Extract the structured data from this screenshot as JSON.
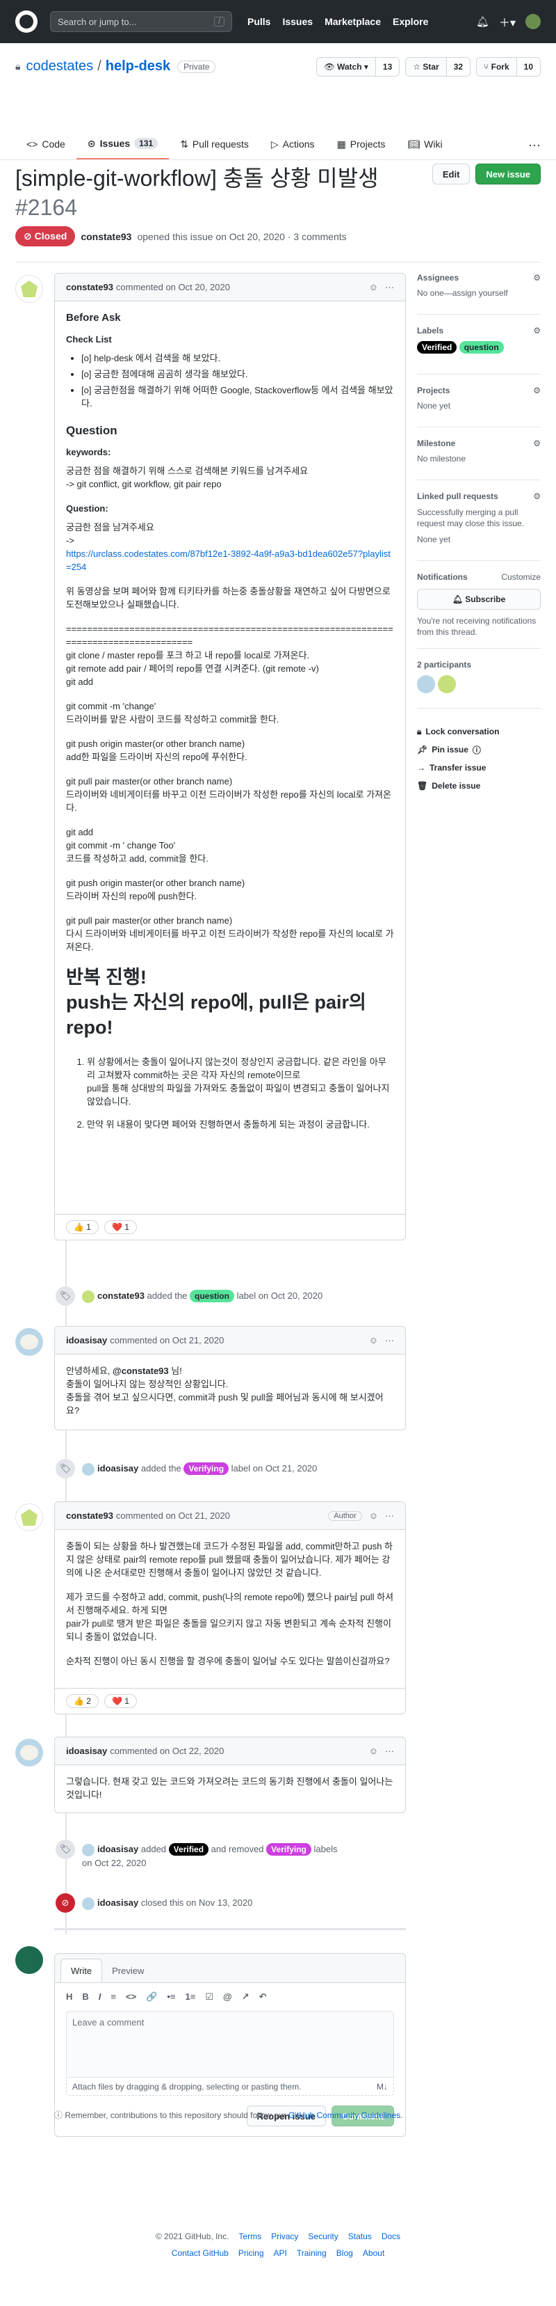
{
  "header": {
    "search_placeholder": "Search or jump to...",
    "slash": "/",
    "nav": [
      "Pulls",
      "Issues",
      "Marketplace",
      "Explore"
    ]
  },
  "repo": {
    "owner": "codestates",
    "name": "help-desk",
    "visibility": "Private",
    "watch": "Watch",
    "watch_count": "13",
    "star": "Star",
    "star_count": "32",
    "fork": "Fork",
    "fork_count": "10"
  },
  "tabs": [
    {
      "label": "Code"
    },
    {
      "label": "Issues",
      "count": "131"
    },
    {
      "label": "Pull requests"
    },
    {
      "label": "Actions"
    },
    {
      "label": "Projects"
    },
    {
      "label": "Wiki"
    }
  ],
  "issue": {
    "title": "[simple-git-workflow] 충돌 상황 미발생",
    "number": "#2164",
    "edit": "Edit",
    "new_issue": "New issue",
    "state": "Closed",
    "author": "constate93",
    "opened_text": "opened this issue on Oct 20, 2020 · 3 comments"
  },
  "c1": {
    "author": "constate93",
    "meta": "commented on Oct 20, 2020",
    "h_before": "Before Ask",
    "h_check": "Check List",
    "checks": [
      "[o] help-desk 에서 검색을 해 보았다.",
      "[o] 궁금한 점에대해 곰곰히 생각을 해보았다.",
      "[o] 궁금한점을 해결하기 위해 어떠한 Google, Stackoverflow등 에서 검색을 해보았다."
    ],
    "h_question": "Question",
    "kw_label": "keywords:",
    "kw1": "궁금한 점을 해결하기 위해 스스로 검색해본 키워드를 남겨주세요",
    "kw2": "-> git conflict, git workflow, git pair repo",
    "q_label": "Question:",
    "q1": "궁금한 점을 남겨주세요",
    "q2": "->",
    "link": "https://urclass.codestates.com/87bf12e1-3892-4a9f-a9a3-bd1dea602e57?playlist=254",
    "p1": "위 동영상을 보며 페어와 함께 티키타카를 하는중 충돌상황을 재연하고 싶어 다방면으로 도전해보았으나 실패했습니다.",
    "eq": "======================================================================================",
    "p2": "git clone / master repo를 포크 하고 내 repo를 local로 가져온다.\ngit remote add pair / 페어의 repo를 연결 시켜준다. (git remote -v)\ngit add",
    "p3": "git commit -m 'change'\n드라이버를 맡은 사람이 코드를 작성하고 commit을 한다.",
    "p4": "git push origin master(or other branch name)\nadd한 파일을 드라이버 자신의 repo에 푸쉬한다.",
    "p5": "git pull pair master(or other branch name)\n드라이버와 네비게이터를 바꾸고 이전 드라이버가 작성한 repo를 자신의 local로 가져온다.",
    "p6": "git add\ngit commit -m ' change Too'\n코드를 작성하고 add, commit을 한다.",
    "p7": "git push origin master(or other branch name)\n드라이버 자신의 repo에 push한다.",
    "p8": "git pull pair master(or other branch name)\n다시 드라이버와 네비게이터를 바꾸고 이전 드라이버가 작성한 repo를 자신의 local로 가져온다.",
    "big": "반복 진행!\npush는 자신의 repo에, pull은 pair의 repo!",
    "ol": [
      "위 상황에서는 충돌이 일어나지 않는것이 정상인지 궁금합니다. 같은 라인을 아무리 고쳐봤자 commit하는 곳은 각자 자신의 remote이므로\npull을 통해 상대방의 파일을 가져와도 충돌없이 파일이 변경되고 충돌이 일어나지 않았습니다.",
      "만약 위 내용이 맞다면 페어와 진행하면서 충돌하게 되는 과정이 궁금합니다."
    ],
    "r_thumb": "👍 1",
    "r_heart": "❤️ 1"
  },
  "e1": {
    "actor": "constate93",
    "pre": "added the",
    "label": "question",
    "post": "label on Oct 20, 2020"
  },
  "c2": {
    "author": "idoasisay",
    "meta": "commented on Oct 21, 2020",
    "l1a": "안녕하세요, ",
    "mention": "@constate93",
    "l1b": " 님!",
    "l2": "충돌이 일어나지 않는 정상적인 상황입니다.",
    "l3": "충돌을 겪어 보고 싶으시다면, commit과 push 및 pull을 페어님과 동시에 해 보시겠어요?"
  },
  "e2": {
    "actor": "idoasisay",
    "pre": "added the",
    "label": "Verifying",
    "post": "label on Oct 21, 2020"
  },
  "c3": {
    "author": "constate93",
    "meta": "commented on Oct 21, 2020",
    "badge": "Author",
    "p1": "충돌이 되는 상황을 하나 발견했는데 코드가 수정된 파일을 add, commit만하고 push 하지 않은 상태로 pair의 remote repo를 pull 했을때 충돌이 일어났습니다. 제가 페어는 강의에 나온 순서대로만 진행해서 충돌이 일어나지 않았던 것 같습니다.",
    "p2": "제가 코드를 수정하고 add, commit, push(나의 remote repo에) 했으나 pair님 pull 하셔서 진행해주세요. 하게 되면\npair가 pull로 땡겨 받은 파일은 충돌을 일으키지 않고 자동 변환되고 계속 순차적 진행이 되니 충돌이 없었습니다.",
    "p3": "순차적 진행이 아닌 동시 진행을 할 경우에 충돌이 일어날 수도 있다는 말씀이신걸까요?",
    "r_thumb": "👍 2",
    "r_heart": "❤️ 1"
  },
  "c4": {
    "author": "idoasisay",
    "meta": "commented on Oct 22, 2020",
    "body": "그렇습니다. 현재 갖고 있는 코드와 가져오려는 코드의 동기화 진행에서 충돌이 일어나는 것입니다!"
  },
  "e3": {
    "actor": "idoasisay",
    "pre": "added",
    "label1": "Verified",
    "mid": "and removed",
    "label2": "Verifying",
    "post": "labels",
    "date": "on Oct 22, 2020"
  },
  "e4": {
    "actor": "idoasisay",
    "text": "closed this on Nov 13, 2020"
  },
  "composer": {
    "tab_write": "Write",
    "tab_preview": "Preview",
    "tools": [
      "H",
      "B",
      "I",
      "≡",
      "<>",
      "🔗",
      "•≡",
      "1≡",
      "☑",
      "@",
      "↗",
      "↶"
    ],
    "placeholder": "Leave a comment",
    "attach": "Attach files by dragging & dropping, selecting or pasting them.",
    "reopen": "Reopen issue",
    "comment": "Comment"
  },
  "guidelines_pre": "Remember, contributions to this repository should follow our ",
  "guidelines_link": "GitHub Community Guidelines",
  "guidelines_post": ".",
  "sidebar": {
    "assignees": "Assignees",
    "assignees_val": "No one—assign yourself",
    "labels": "Labels",
    "label_verified": "Verified",
    "label_question": "question",
    "projects": "Projects",
    "projects_val": "None yet",
    "milestone": "Milestone",
    "milestone_val": "No milestone",
    "linked": "Linked pull requests",
    "linked_desc": "Successfully merging a pull request may close this issue.",
    "linked_val": "None yet",
    "notifications": "Notifications",
    "customize": "Customize",
    "subscribe": "Subscribe",
    "notif_desc": "You're not receiving notifications from this thread.",
    "participants": "2 participants",
    "lock": "Lock conversation",
    "pin": "Pin issue",
    "transfer": "Transfer issue",
    "delete": "Delete issue"
  },
  "footer": {
    "copy": "© 2021 GitHub, Inc.",
    "row1": [
      "Terms",
      "Privacy",
      "Security",
      "Status",
      "Docs"
    ],
    "row2": [
      "Contact GitHub",
      "Pricing",
      "API",
      "Training",
      "Blog",
      "About"
    ]
  },
  "colors": {
    "label_question": "#55e39a",
    "label_verified": "#000000",
    "label_verifying": "#cc3fe0",
    "closed": "#d73a49",
    "green": "#2ea44f"
  }
}
